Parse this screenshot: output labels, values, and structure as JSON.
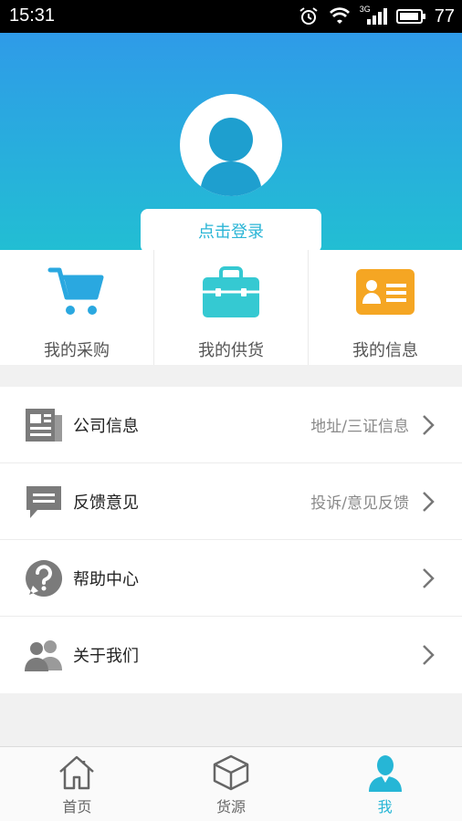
{
  "status_bar": {
    "time": "15:31",
    "network": "3G",
    "battery": "77"
  },
  "header": {
    "login_label": "点击登录"
  },
  "quick_actions": [
    {
      "label": "我的采购",
      "icon": "cart-icon"
    },
    {
      "label": "我的供货",
      "icon": "bag-icon"
    },
    {
      "label": "我的信息",
      "icon": "id-card-icon"
    }
  ],
  "menu": [
    {
      "title": "公司信息",
      "hint": "地址/三证信息",
      "icon": "newspaper-icon"
    },
    {
      "title": "反馈意见",
      "hint": "投诉/意见反馈",
      "icon": "message-icon"
    },
    {
      "title": "帮助中心",
      "hint": "",
      "icon": "help-icon"
    },
    {
      "title": "关于我们",
      "hint": "",
      "icon": "people-icon"
    }
  ],
  "tabs": [
    {
      "label": "首页",
      "icon": "home-icon"
    },
    {
      "label": "货源",
      "icon": "box-icon"
    },
    {
      "label": "我",
      "icon": "profile-icon",
      "active": true
    }
  ],
  "colors": {
    "accent": "#26b6d6",
    "header_top": "#2f9be8",
    "header_bottom": "#22bed3",
    "id_card": "#f5a623"
  }
}
